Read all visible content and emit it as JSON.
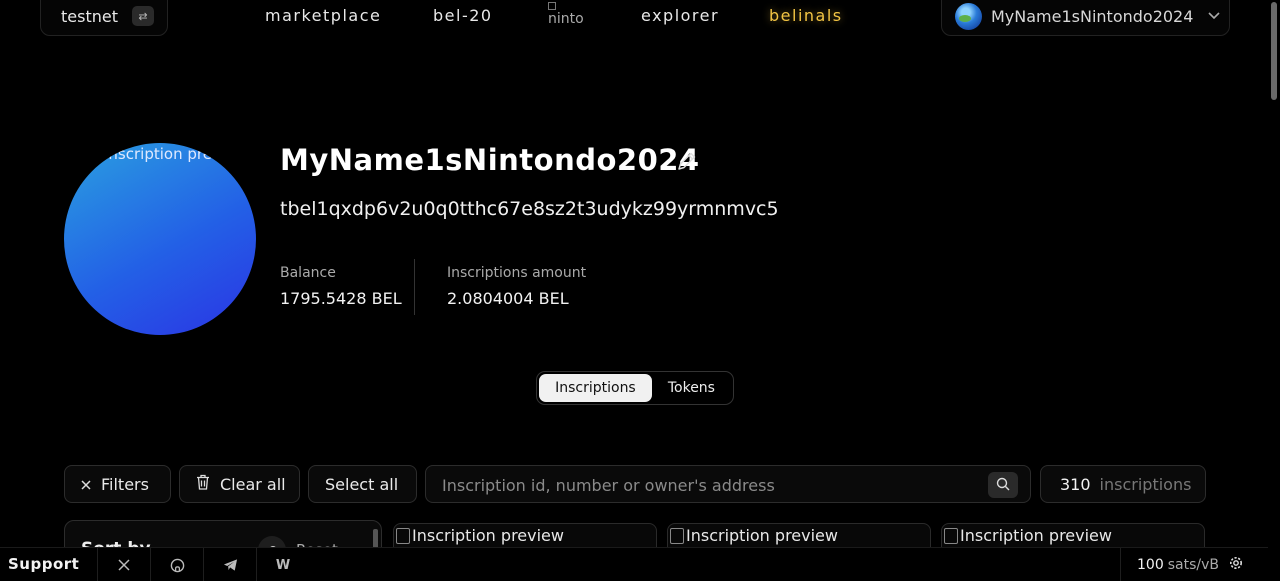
{
  "topbar": {
    "network": "testnet",
    "nav": [
      "marketplace",
      "bel-20",
      "explorer",
      "belinals"
    ],
    "logo_alt": "ninto",
    "account_name": "MyName1sNintondo2024"
  },
  "profile": {
    "avatar_alt": "Inscription preview",
    "name": "MyName1sNintondo2024",
    "address": "tbel1qxdp6v2u0q0tthc67e8sz2t3udykz99yrmnmvc5",
    "balance_label": "Balance",
    "balance_value": "1795.5428 BEL",
    "inscriptions_label": "Inscriptions amount",
    "inscriptions_value": "2.0804004 BEL"
  },
  "tabs": [
    "Inscriptions",
    "Tokens"
  ],
  "filters": {
    "filters_label": "Filters",
    "clear_label": "Clear all",
    "select_label": "Select all",
    "search_placeholder": "Inscription id, number or owner's address",
    "count_number": "310",
    "count_unit": "inscriptions"
  },
  "sort": {
    "title": "Sort by",
    "reset_label": "Reset"
  },
  "cards": [
    "Inscription preview",
    "Inscription preview",
    "Inscription preview"
  ],
  "footer": {
    "support": "Support",
    "socials": [
      "x-icon",
      "github-icon",
      "telegram-icon",
      "w-icon"
    ],
    "fee_value": "100",
    "fee_unit": "sats/vB"
  },
  "colors": {
    "accent": "#f3c544",
    "background": "#000000"
  }
}
